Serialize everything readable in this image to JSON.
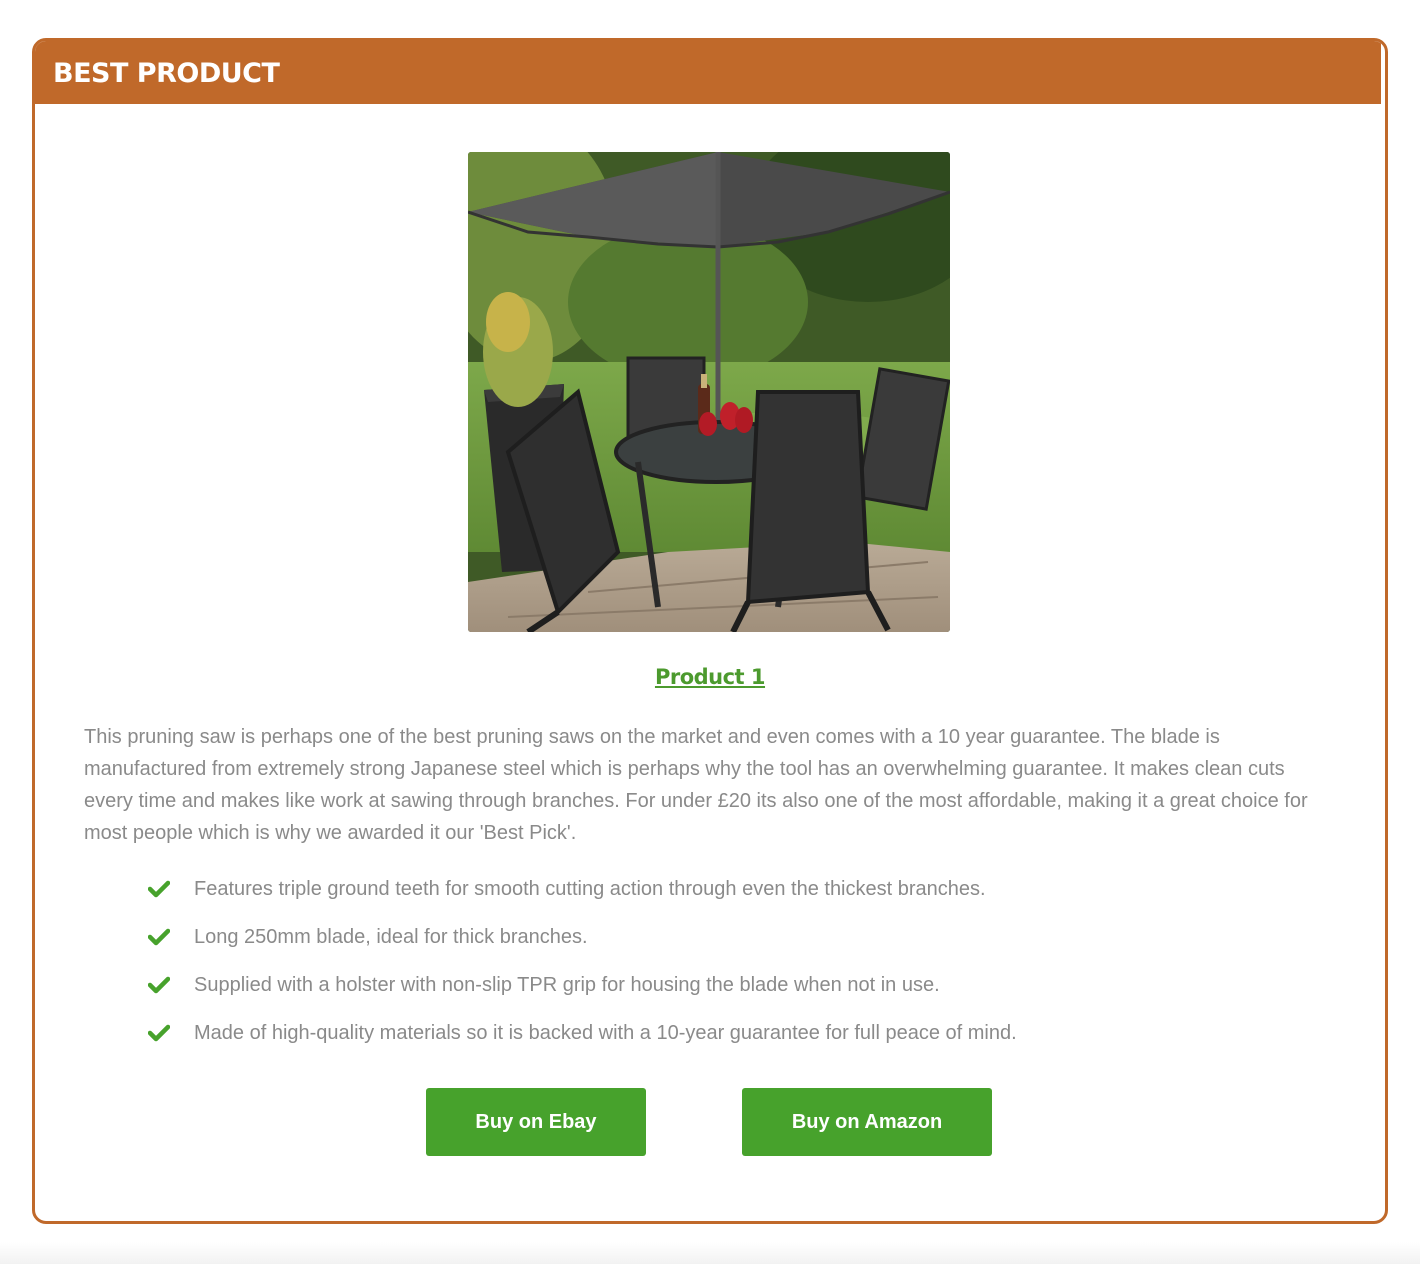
{
  "card": {
    "title": "BEST PRODUCT",
    "accent_color": "#c0692a"
  },
  "product": {
    "image_icon": "patio-furniture-set-photo",
    "name": "Product 1",
    "link_color": "#4c9a2e",
    "description": "This pruning saw is perhaps one of the best pruning saws on the market and even comes with a 10 year guarantee. The blade is manufactured from extremely strong Japanese steel which is perhaps why the tool has an overwhelming guarantee. It makes clean cuts every time and makes like work at sawing through branches. For under £20 its also one of the most affordable, making it a great choice for most people which is why we awarded it our 'Best Pick'.",
    "features": [
      "Features triple ground teeth for smooth cutting action through even the thickest branches.",
      "Long 250mm blade, ideal for thick branches.",
      "Supplied with a holster with non-slip TPR grip for housing the blade when not in use.",
      "Made of high-quality materials so it is backed with a 10-year guarantee for full peace of mind."
    ],
    "feature_icon": "check-icon",
    "check_color": "#47a22c"
  },
  "buttons": {
    "ebay": "Buy on Ebay",
    "amazon": "Buy on Amazon",
    "color": "#47a22c"
  }
}
